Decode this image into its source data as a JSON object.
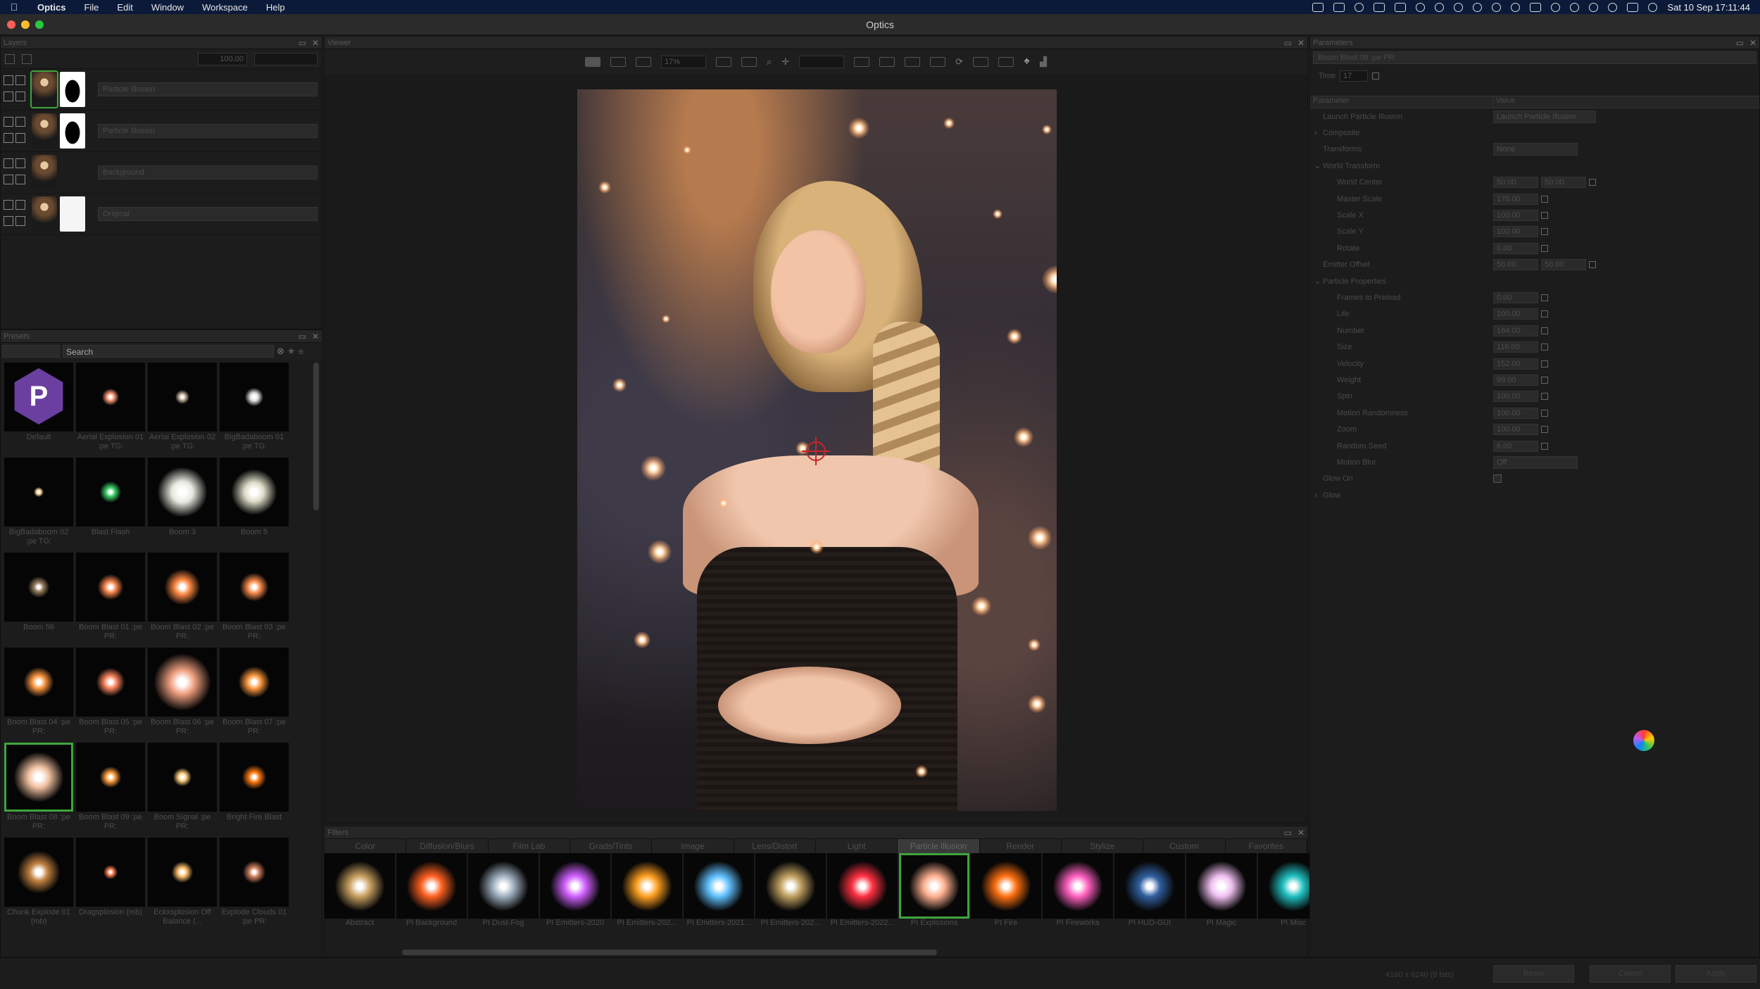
{
  "menubar": {
    "app_name": "Optics",
    "items": [
      "File",
      "Edit",
      "Window",
      "Workspace",
      "Help"
    ],
    "clock": "Sat 10 Sep  17:11:44"
  },
  "window": {
    "title": "Optics"
  },
  "layers": {
    "title": "Layers",
    "opacity": "100.00",
    "rows": [
      {
        "name": "Particle Illusion",
        "thumb": "portrait",
        "mask": "mask",
        "selected": true
      },
      {
        "name": "Particle Illusion",
        "thumb": "portrait",
        "mask": "mask",
        "selected": false
      },
      {
        "name": "Background",
        "thumb": "portrait",
        "mask": "",
        "selected": false
      },
      {
        "name": "Original",
        "thumb": "portrait",
        "mask": "white",
        "selected": false
      }
    ]
  },
  "presets": {
    "title": "Presets",
    "search_placeholder": "Search",
    "items": [
      {
        "label": "Default",
        "kind": "logo"
      },
      {
        "label": "Aerial Explosion 01 :pe TG:",
        "kind": "burst",
        "color": "#ff9a7a",
        "size": 24
      },
      {
        "label": "Aerial Explosion 02 :pe TG:",
        "kind": "burst",
        "color": "#c9b8a0",
        "size": 20
      },
      {
        "label": "BigBadaboom 01 :pe TG:",
        "kind": "burst",
        "color": "#e0e0e0",
        "size": 26
      },
      {
        "label": "BigBadaboom 02 :pe TG:",
        "kind": "burst",
        "color": "#ffdca0",
        "size": 14
      },
      {
        "label": "Blast Flash",
        "kind": "burst",
        "color": "#3cd068",
        "size": 30
      },
      {
        "label": "Boom 3",
        "kind": "burst",
        "color": "#e8e8e0",
        "size": 70
      },
      {
        "label": "Boom 5",
        "kind": "burst",
        "color": "#dcdcc8",
        "size": 64
      },
      {
        "label": "Boom 56",
        "kind": "burst",
        "color": "#9a8060",
        "size": 30
      },
      {
        "label": "Boom Blast 01 :pe PR:",
        "kind": "burst",
        "color": "#ff8a50",
        "size": 36
      },
      {
        "label": "Boom Blast 02 :pe PR:",
        "kind": "burst",
        "color": "#ff8844",
        "size": 50
      },
      {
        "label": "Boom Blast 03 :pe PR:",
        "kind": "burst",
        "color": "#ff9050",
        "size": 40
      },
      {
        "label": "Boom Blast 04 :pe PR:",
        "kind": "burst",
        "color": "#ff9940",
        "size": 42
      },
      {
        "label": "Boom Blast 05 :pe PR:",
        "kind": "burst",
        "color": "#ff8860",
        "size": 40
      },
      {
        "label": "Boom Blast 06 :pe PR:",
        "kind": "burst",
        "color": "#f0a080",
        "size": 80
      },
      {
        "label": "Boom Blast 07 :pe PR:",
        "kind": "burst",
        "color": "#ff9a40",
        "size": 44
      },
      {
        "label": "Boom Blast 08 :pe PR:",
        "kind": "burst",
        "color": "#f0c0a0",
        "size": 70,
        "selected": true
      },
      {
        "label": "Boom Blast 09 :pe PR:",
        "kind": "burst",
        "color": "#ffa040",
        "size": 30
      },
      {
        "label": "Boom Signal :pe PR:",
        "kind": "burst",
        "color": "#ffd080",
        "size": 26
      },
      {
        "label": "Bright Fire Blast",
        "kind": "burst",
        "color": "#ff7a10",
        "size": 34
      },
      {
        "label": "Chunk Explode 01 (mb)",
        "kind": "burst",
        "color": "#c08040",
        "size": 60
      },
      {
        "label": "Dragsplosion (mb)",
        "kind": "burst",
        "color": "#ff8050",
        "size": 20
      },
      {
        "label": "Eckxsplosion Off Balance (...",
        "kind": "burst",
        "color": "#ffc070",
        "size": 30
      },
      {
        "label": "Explode Clouds 01 :pe PR:",
        "kind": "burst",
        "color": "#d08060",
        "size": 32
      }
    ]
  },
  "viewer": {
    "title": "Viewer",
    "zoom": "17%"
  },
  "filters": {
    "title": "Filters",
    "tabs": [
      "Color",
      "Diffusion/Blurs",
      "Film Lab",
      "Grads/Tints",
      "Image",
      "Lens/Distort",
      "Light",
      "Particle Illusion",
      "Render",
      "Stylize",
      "Custom",
      "Favorites"
    ],
    "active_tab": "Particle Illusion",
    "items": [
      {
        "label": "Abstract",
        "color": "#c8a060",
        "selected": false
      },
      {
        "label": "PI Background",
        "color": "#ff6020",
        "selected": false
      },
      {
        "label": "PI Dust-Fog",
        "color": "#a0b0c0",
        "selected": false
      },
      {
        "label": "PI Emitters-2020",
        "color": "#d060ff",
        "selected": false
      },
      {
        "label": "PI Emitters-202...",
        "color": "#ffa020",
        "selected": false
      },
      {
        "label": "PI Emitters-2021...",
        "color": "#60c0ff",
        "selected": false
      },
      {
        "label": "PI Emitters-202...",
        "color": "#c0a060",
        "selected": false
      },
      {
        "label": "PI Emitters-2022...",
        "color": "#ff3040",
        "selected": false
      },
      {
        "label": "PI Explosions",
        "color": "#ffb090",
        "selected": true
      },
      {
        "label": "PI Fire",
        "color": "#ff7010",
        "selected": false
      },
      {
        "label": "PI Fireworks",
        "color": "#ff60c0",
        "selected": false
      },
      {
        "label": "PI HUD-GUI",
        "color": "#3060a0",
        "selected": false
      },
      {
        "label": "PI Magic",
        "color": "#f0c0f0",
        "selected": false
      },
      {
        "label": "PI Misc",
        "color": "#20c0c0",
        "selected": false
      }
    ]
  },
  "parameters": {
    "title": "Parameters",
    "preset_title": "Boom Blast 08 :pe PR:",
    "time_label": "Time",
    "time_value": "17",
    "col_param": "Parameter",
    "col_value": "Value",
    "rows": [
      {
        "name": "Launch Particle Illusion",
        "level": 0,
        "kind": "button",
        "value": "Launch Particle Illusion"
      },
      {
        "name": "Composite",
        "level": 0,
        "arrow": "›",
        "kind": "none"
      },
      {
        "name": "Transforms",
        "level": 0,
        "kind": "dropdown",
        "value": "None"
      },
      {
        "name": "World Transform",
        "level": 0,
        "arrow": "⌄",
        "kind": "none"
      },
      {
        "name": "World Center",
        "level": 1,
        "kind": "pair",
        "value": "50.00",
        "value2": "50.00"
      },
      {
        "name": "Master Scale",
        "level": 1,
        "kind": "field",
        "value": "176.00"
      },
      {
        "name": "Scale X",
        "level": 1,
        "kind": "field",
        "value": "100.00"
      },
      {
        "name": "Scale Y",
        "level": 1,
        "kind": "field",
        "value": "100.00"
      },
      {
        "name": "Rotate",
        "level": 1,
        "kind": "field",
        "value": "0.00"
      },
      {
        "name": "Emitter Offset",
        "level": 0,
        "kind": "pair",
        "value": "50.00",
        "value2": "50.00"
      },
      {
        "name": "Particle Properties",
        "level": 0,
        "arrow": "⌄",
        "kind": "none"
      },
      {
        "name": "Frames to Preload",
        "level": 1,
        "kind": "field",
        "value": "0.00"
      },
      {
        "name": "Life",
        "level": 1,
        "kind": "field",
        "value": "100.00"
      },
      {
        "name": "Number",
        "level": 1,
        "kind": "field",
        "value": "164.00"
      },
      {
        "name": "Size",
        "level": 1,
        "kind": "field",
        "value": "116.00"
      },
      {
        "name": "Velocity",
        "level": 1,
        "kind": "field",
        "value": "152.00"
      },
      {
        "name": "Weight",
        "level": 1,
        "kind": "field",
        "value": "99.00"
      },
      {
        "name": "Spin",
        "level": 1,
        "kind": "field",
        "value": "100.00"
      },
      {
        "name": "Motion Randomness",
        "level": 1,
        "kind": "field",
        "value": "100.00"
      },
      {
        "name": "Zoom",
        "level": 1,
        "kind": "field",
        "value": "100.00"
      },
      {
        "name": "Random Seed",
        "level": 1,
        "kind": "field",
        "value": "6.00"
      },
      {
        "name": "Motion Blur",
        "level": 1,
        "kind": "dropdown",
        "value": "Off"
      },
      {
        "name": "Glow On",
        "level": 0,
        "kind": "check"
      },
      {
        "name": "Glow",
        "level": 0,
        "arrow": "›",
        "kind": "none"
      }
    ]
  },
  "status": {
    "image_info": "4160 x 6240 (8 bits)",
    "buttons": [
      "Reset",
      "Cancel",
      "Apply"
    ]
  }
}
